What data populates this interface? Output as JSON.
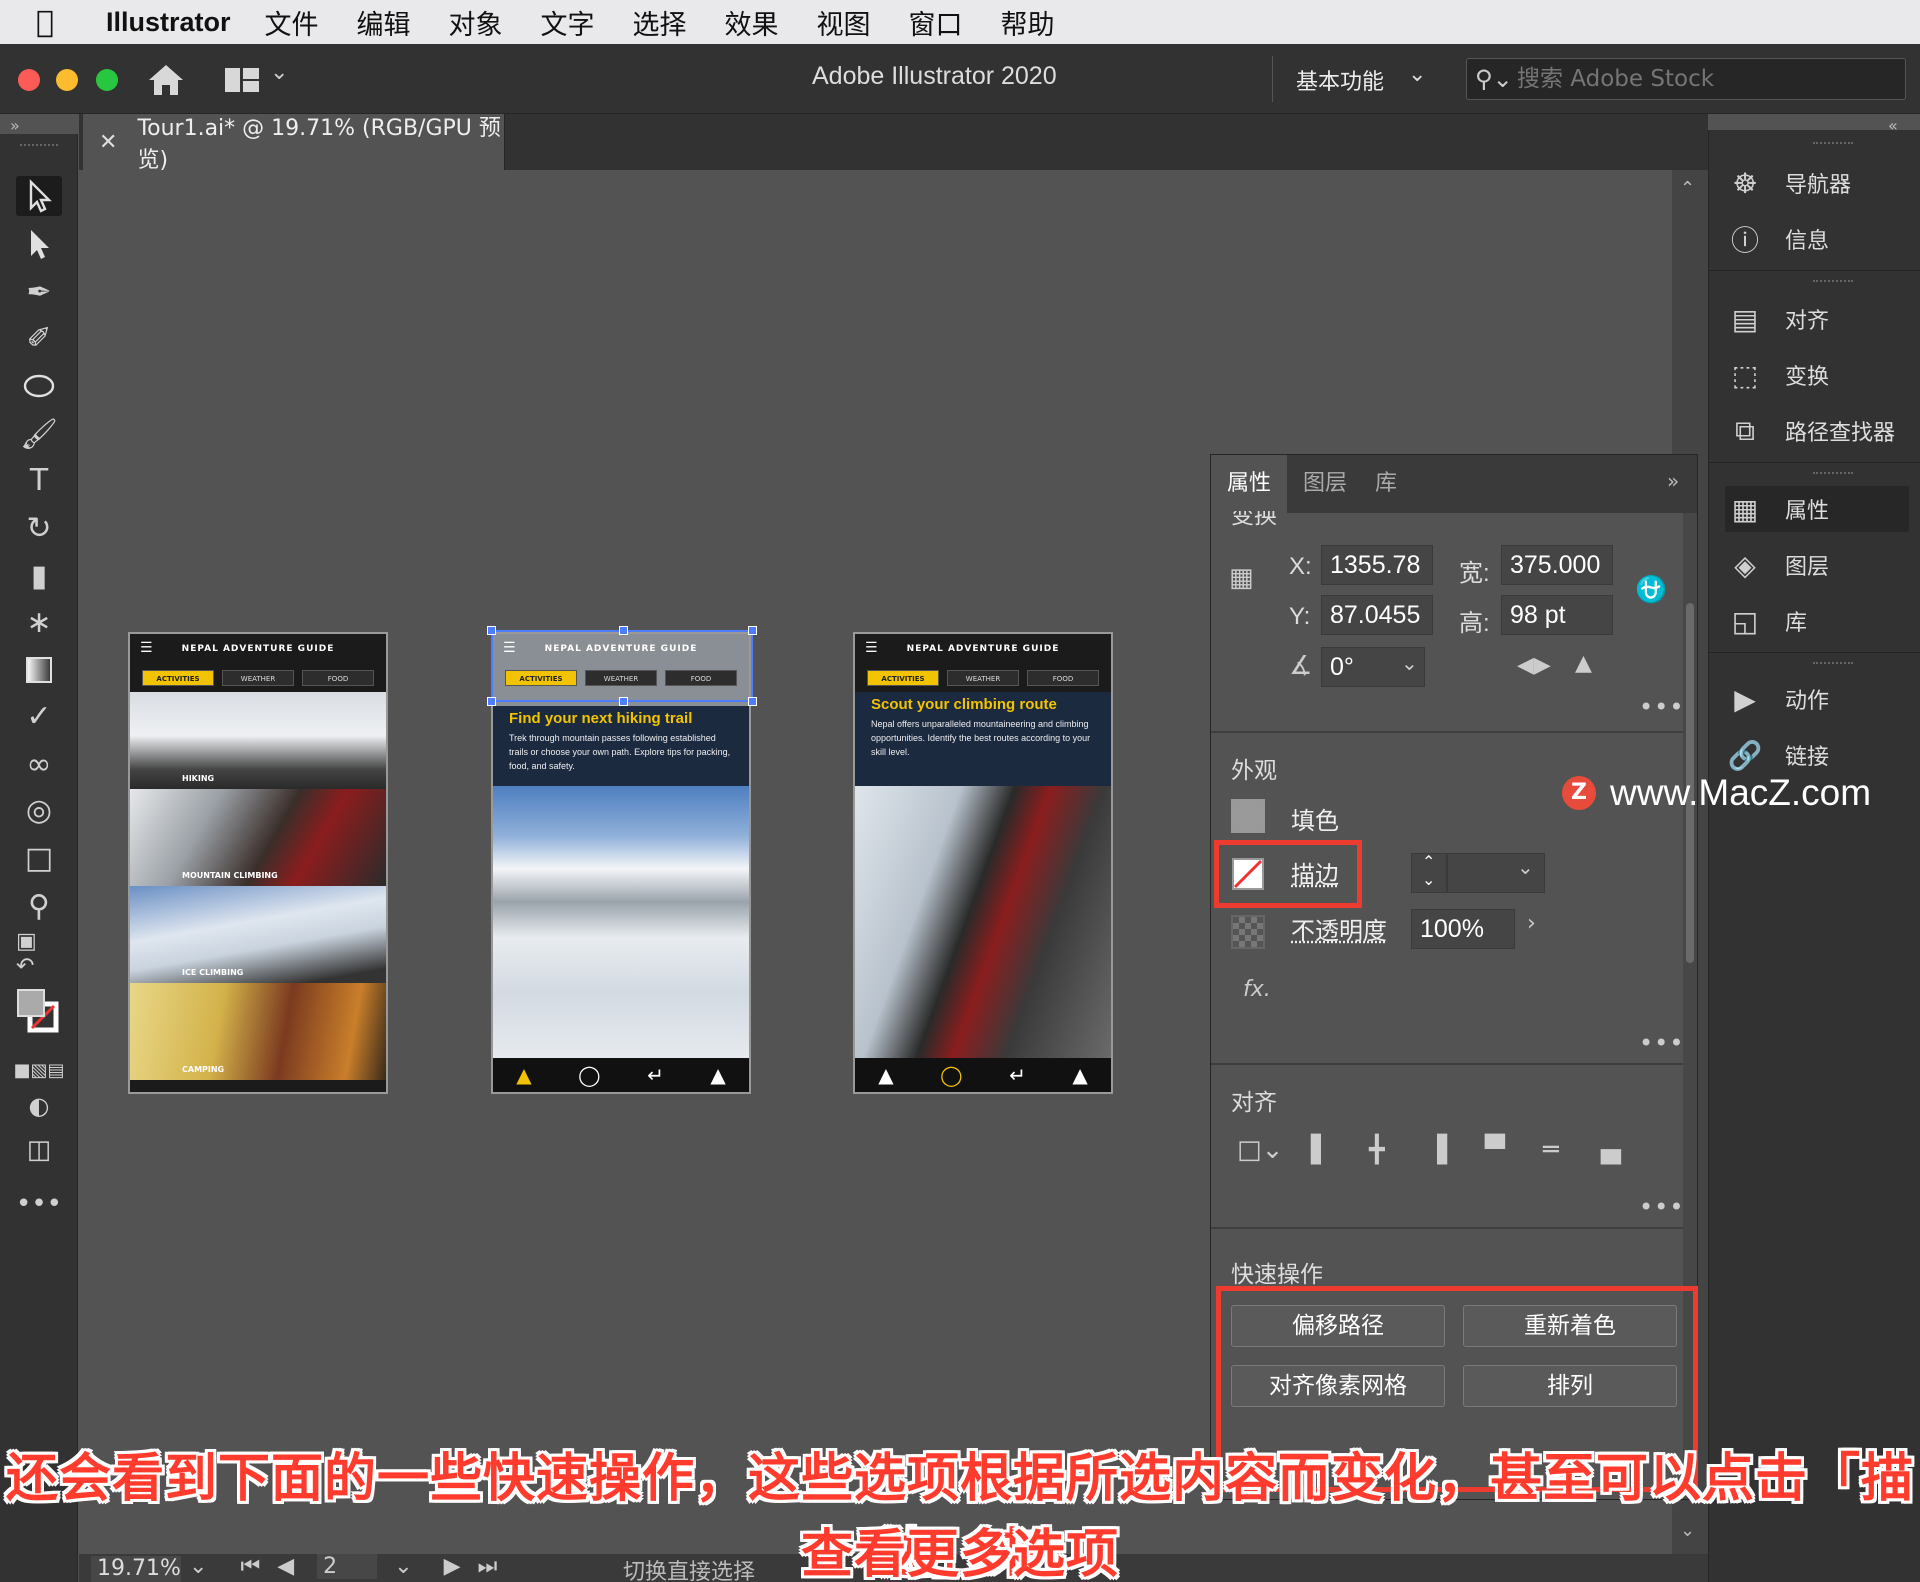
{
  "menubar": {
    "app": "Illustrator",
    "items": [
      "文件",
      "编辑",
      "对象",
      "文字",
      "选择",
      "效果",
      "视图",
      "窗口",
      "帮助"
    ]
  },
  "titlebar": {
    "title": "Adobe Illustrator 2020",
    "workspace": "基本功能",
    "stock_placeholder": "搜索 Adobe Stock"
  },
  "document": {
    "tab_title": "Tour1.ai* @ 19.71% (RGB/GPU 预览)"
  },
  "artboards": {
    "brand": "NEPAL ADVENTURE GUIDE",
    "tabs": [
      "ACTIVITIES",
      "WEATHER",
      "FOOD"
    ],
    "ab1_rows": [
      "HIKING",
      "MOUNTAIN CLIMBING",
      "ICE CLIMBING",
      "CAMPING"
    ],
    "ab2_heading_a": "Find your next ",
    "ab2_heading_b": "hiking trail",
    "ab2_text": "Trek through mountain passes following established trails or choose your own path. Explore tips for packing, food, and safety.",
    "ab3_heading_a": "Scout your ",
    "ab3_heading_b": "climbing route",
    "ab3_text": "Nepal offers unparalleled mountaineering and climbing opportunities. Identify the best routes according to your skill level."
  },
  "dock": {
    "items": [
      "导航器",
      "信息",
      "对齐",
      "变换",
      "路径查找器",
      "属性",
      "图层",
      "库",
      "动作",
      "链接"
    ]
  },
  "properties": {
    "tabs": [
      "属性",
      "图层",
      "库"
    ],
    "transform_title": "变换",
    "x_label": "X:",
    "x_value": "1355.78",
    "y_label": "Y:",
    "y_value": "87.0455",
    "w_label": "宽:",
    "w_value": "375.000",
    "h_label": "高:",
    "h_value": "98 pt",
    "angle_value": "0°",
    "appearance_title": "外观",
    "fill_label": "填色",
    "stroke_label": "描边",
    "opacity_label": "不透明度",
    "opacity_value": "100%",
    "fx": "fx.",
    "align_title": "对齐",
    "quick_title": "快速操作",
    "quick_buttons": [
      "偏移路径",
      "重新着色",
      "对齐像素网格",
      "排列"
    ]
  },
  "watermark": {
    "logo": "Z",
    "text": "www.MacZ.com"
  },
  "statusbar": {
    "zoom": "19.71%",
    "page": "2",
    "hint": "切换直接选择"
  },
  "subtitle": {
    "line1": "还会看到下面的一些快速操作，这些选项根据所选内容而变化，甚至可以点击「描边」来",
    "line2": "查看更多选项"
  },
  "colors": {
    "accent_yellow": "#f2c300",
    "selection_blue": "#4e7dff",
    "highlight_red": "#ee3b2f"
  }
}
